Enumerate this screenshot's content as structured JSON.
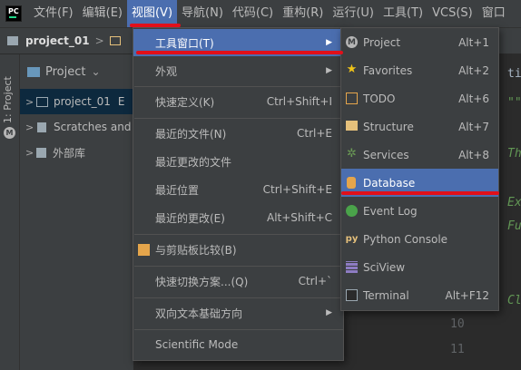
{
  "menubar": {
    "logo_text": "PC",
    "items": [
      {
        "label": "文件(F)"
      },
      {
        "label": "编辑(E)"
      },
      {
        "label": "视图(V)"
      },
      {
        "label": "导航(N)"
      },
      {
        "label": "代码(C)"
      },
      {
        "label": "重构(R)"
      },
      {
        "label": "运行(U)"
      },
      {
        "label": "工具(T)"
      },
      {
        "label": "VCS(S)"
      },
      {
        "label": "窗口"
      }
    ]
  },
  "navbar": {
    "project": "project_01",
    "chevron": ">"
  },
  "side_stripe": {
    "tab_label": "1: Project"
  },
  "project_panel": {
    "title": "Project",
    "title_chevron": "⌄",
    "tree": [
      {
        "label": "project_01",
        "arrow": ">",
        "trailing": "E"
      },
      {
        "label": "Scratches and",
        "arrow": ">"
      },
      {
        "label": "外部库",
        "arrow": ">"
      }
    ]
  },
  "editor": {
    "line_numbers": [
      "10",
      "11"
    ],
    "fragments": [
      {
        "text": "tir"
      },
      {
        "text": "\"\""
      },
      {
        "text": "Th"
      },
      {
        "text": "Ex"
      },
      {
        "text": "Fu"
      },
      {
        "text": "Cl"
      }
    ]
  },
  "view_menu": {
    "items": [
      {
        "label": "工具窗口(T)",
        "shortcut": "",
        "submenu": true,
        "highlighted": true
      },
      {
        "label": "外观",
        "shortcut": "",
        "submenu": true
      },
      {
        "label": "快速定义(K)",
        "shortcut": "Ctrl+Shift+I"
      },
      {
        "label": "最近的文件(N)",
        "shortcut": "Ctrl+E"
      },
      {
        "label": "最近更改的文件",
        "shortcut": ""
      },
      {
        "label": "最近位置",
        "shortcut": "Ctrl+Shift+E"
      },
      {
        "label": "最近的更改(E)",
        "shortcut": "Alt+Shift+C"
      },
      {
        "label": "与剪贴板比较(B)",
        "shortcut": ""
      },
      {
        "label": "快速切换方案...(Q)",
        "shortcut": "Ctrl+`"
      },
      {
        "label": "双向文本基础方向",
        "shortcut": "",
        "submenu": true
      },
      {
        "label": "Scientific Mode",
        "shortcut": ""
      }
    ],
    "submenu_arrow": "▶"
  },
  "tool_windows_menu": {
    "items": [
      {
        "label": "Project",
        "shortcut": "Alt+1",
        "icon": "project-icon"
      },
      {
        "label": "Favorites",
        "shortcut": "Alt+2",
        "icon": "star-icon"
      },
      {
        "label": "TODO",
        "shortcut": "Alt+6",
        "icon": "todo-icon"
      },
      {
        "label": "Structure",
        "shortcut": "Alt+7",
        "icon": "structure-icon"
      },
      {
        "label": "Services",
        "shortcut": "Alt+8",
        "icon": "services-icon"
      },
      {
        "label": "Database",
        "shortcut": "",
        "icon": "database-icon",
        "highlighted": true
      },
      {
        "label": "Event Log",
        "shortcut": "",
        "icon": "event-log-icon"
      },
      {
        "label": "Python Console",
        "shortcut": "",
        "icon": "python-console-icon"
      },
      {
        "label": "SciView",
        "shortcut": "",
        "icon": "sciview-icon"
      },
      {
        "label": "Terminal",
        "shortcut": "Alt+F12",
        "icon": "terminal-icon"
      }
    ]
  },
  "colors": {
    "highlight": "#4b6eaf",
    "annotation_red": "#e0101a"
  }
}
